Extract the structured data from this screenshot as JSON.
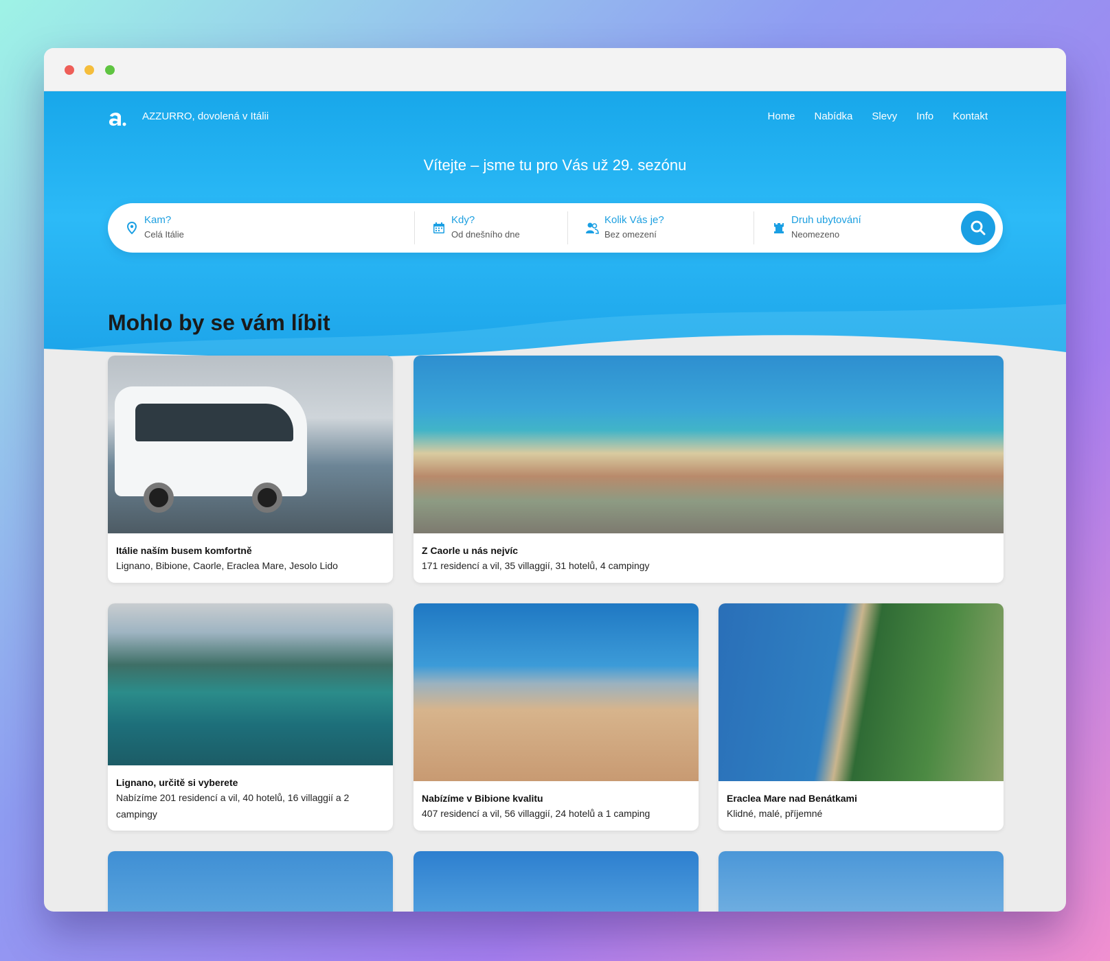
{
  "header": {
    "brand": "AZZURRO, dovolená v Itálii",
    "nav": [
      "Home",
      "Nabídka",
      "Slevy",
      "Info",
      "Kontakt"
    ],
    "welcome": "Vítejte – jsme tu pro Vás už 29. sezónu"
  },
  "search": {
    "where": {
      "label": "Kam?",
      "value": "Celá Itálie",
      "icon": "location-pin-icon"
    },
    "when": {
      "label": "Kdy?",
      "value": "Od dnešního dne",
      "icon": "calendar-icon"
    },
    "people": {
      "label": "Kolik Vás je?",
      "value": "Bez omezení",
      "icon": "people-icon"
    },
    "type": {
      "label": "Druh ubytování",
      "value": "Neomezeno",
      "icon": "tower-icon"
    }
  },
  "section": {
    "title": "Mohlo by se vám líbit"
  },
  "cards": [
    {
      "title": "Itálie naším busem komfortně",
      "subtitle": "Lignano, Bibione, Caorle, Eraclea Mare, Jesolo Lido"
    },
    {
      "title": "Z Caorle u nás nejvíc",
      "subtitle": "171 residencí a vil, 35 villaggií, 31 hotelů, 4 campingy"
    },
    {
      "title": "Lignano, určitě si vyberete",
      "subtitle": "Nabízíme 201 residencí a vil, 40 hotelů, 16 villaggií a 2 campingy"
    },
    {
      "title": "Nabízíme v Bibione kvalitu",
      "subtitle": "407 residencí a vil, 56 villaggií, 24 hotelů a 1 camping"
    },
    {
      "title": "Eraclea Mare nad Benátkami",
      "subtitle": "Klidné, malé, příjemné"
    }
  ],
  "colors": {
    "accent": "#1a9fe3",
    "hero": "#2cbaf7"
  }
}
